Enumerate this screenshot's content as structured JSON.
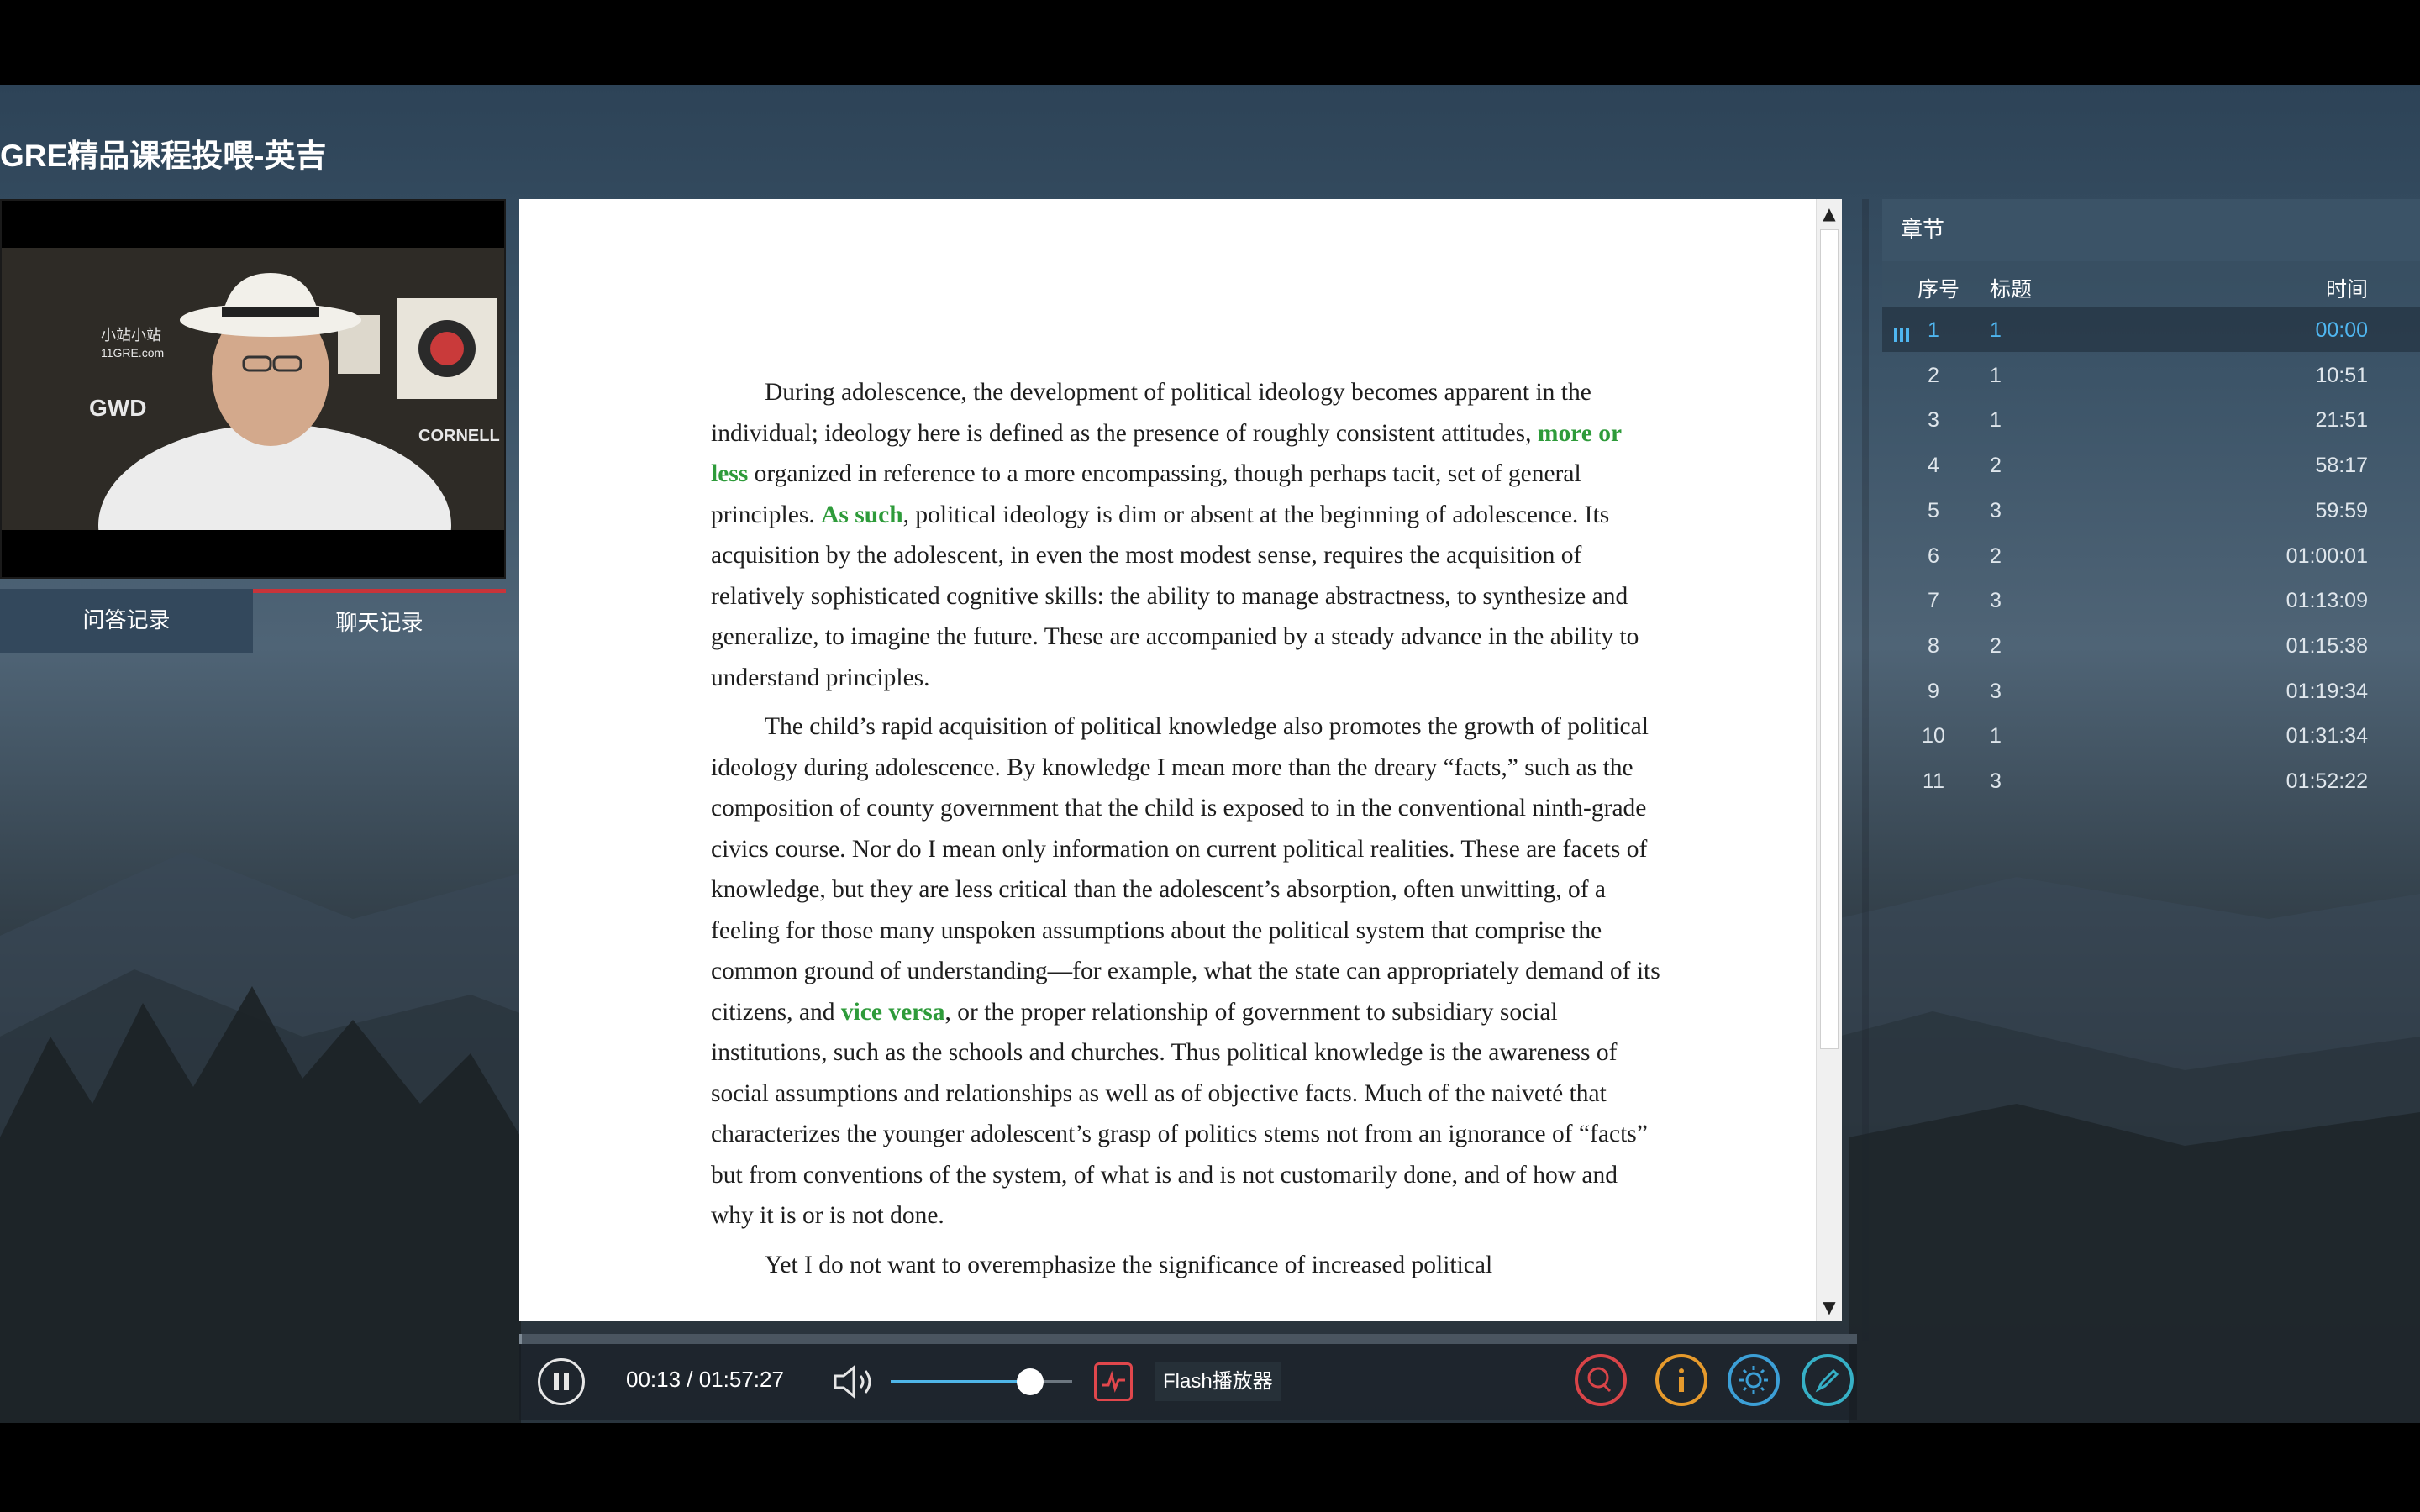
{
  "app": {
    "title": "GRE精品课程投喂-英吉"
  },
  "left_panel": {
    "tabs": [
      "问答记录",
      "聊天记录"
    ],
    "video_overlay_text": [
      "小站小站",
      "11GRE.com",
      "GWD",
      "CORNELL"
    ]
  },
  "document": {
    "paragraphs": [
      [
        {
          "text": "During adolescence, the development of political ideology becomes apparent in the individual; ideology here is defined as the presence of roughly consistent attitudes, "
        },
        {
          "text": "more or less",
          "highlight": true
        },
        {
          "text": " organized in reference to a more encompassing, though perhaps tacit, set of general principles. "
        },
        {
          "text": "As such",
          "highlight": true
        },
        {
          "text": ", political ideology is dim or absent at the beginning of adolescence. Its acquisition by the adolescent, in even the most modest sense, requires the acquisition of relatively sophisticated cognitive skills: the ability to manage abstractness, to synthesize and generalize, to imagine the future. These are accompanied by a steady advance in the ability to understand principles."
        }
      ],
      [
        {
          "text": "The child’s rapid acquisition of political knowledge also promotes the growth of political ideology during adolescence. By knowledge I mean more than the dreary “facts,” such as the composition of county government that the child is exposed to in the conventional ninth-grade civics course. Nor do I mean only information on current political realities. These are facets of knowledge, but they are less critical than the adolescent’s absorption, often unwitting, of a feeling for those many unspoken assumptions about the political system that comprise the common ground of understanding—for example, what the state can appropriately demand of its citizens, and "
        },
        {
          "text": "vice versa",
          "highlight": true
        },
        {
          "text": ", or the proper relationship of government to subsidiary social institutions, such as the schools and churches. Thus political knowledge is the awareness of social assumptions and relationships as well as of objective facts. Much of the naiveté that characterizes the younger adolescent’s grasp of politics stems not from an ignorance of “facts” but from conventions of the system, of what is and is not customarily done, and of how and why it is or is not done."
        }
      ],
      [
        {
          "text": "Yet I do not want to overemphasize the significance of increased political"
        }
      ]
    ]
  },
  "controls": {
    "time_display": "00:13 / 01:57:27",
    "progress_fraction": 0.002,
    "volume_fraction": 0.77,
    "flash_label": "Flash播放器"
  },
  "chapters": {
    "header": "章节",
    "columns": {
      "index": "序号",
      "title": "标题",
      "time": "时间"
    },
    "rows": [
      {
        "index": "1",
        "title": "1",
        "time": "00:00",
        "active": true
      },
      {
        "index": "2",
        "title": "1",
        "time": "10:51"
      },
      {
        "index": "3",
        "title": "1",
        "time": "21:51"
      },
      {
        "index": "4",
        "title": "2",
        "time": "58:17"
      },
      {
        "index": "5",
        "title": "3",
        "time": "59:59"
      },
      {
        "index": "6",
        "title": "2",
        "time": "01:00:01"
      },
      {
        "index": "7",
        "title": "3",
        "time": "01:13:09"
      },
      {
        "index": "8",
        "title": "2",
        "time": "01:15:38"
      },
      {
        "index": "9",
        "title": "3",
        "time": "01:19:34"
      },
      {
        "index": "10",
        "title": "1",
        "time": "01:31:34"
      },
      {
        "index": "11",
        "title": "3",
        "time": "01:52:22"
      }
    ]
  },
  "colors": {
    "highlight_green": "#2e9b3a",
    "active_blue": "#4fb6f0",
    "tab_accent": "#c8343a"
  }
}
